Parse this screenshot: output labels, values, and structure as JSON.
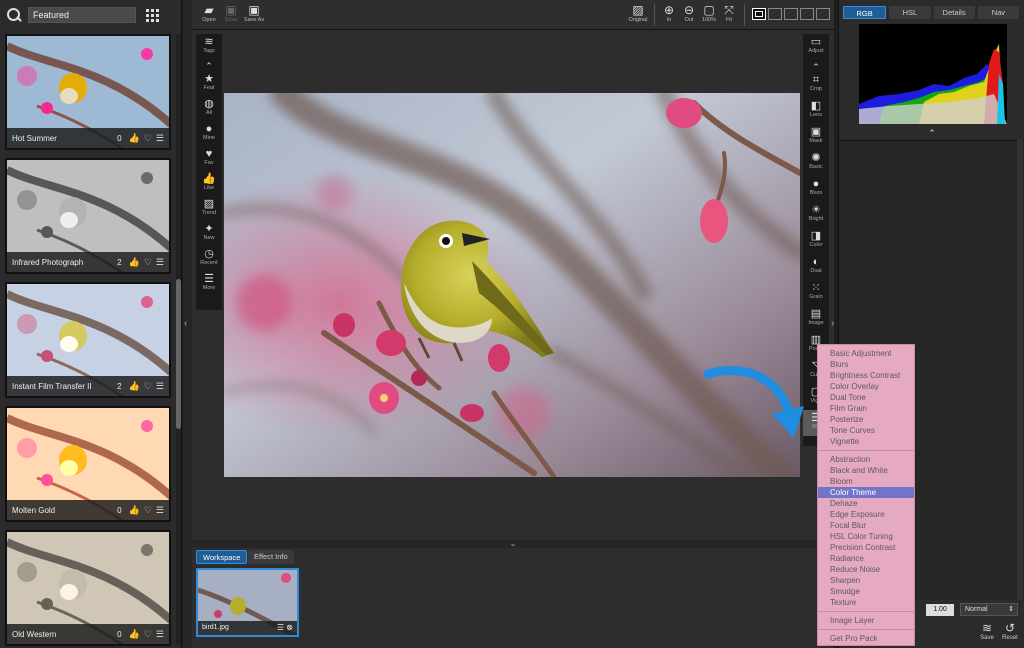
{
  "search": {
    "value": "Featured"
  },
  "presets": [
    {
      "name": "Hot Summer",
      "likes": "0",
      "liked": false
    },
    {
      "name": "Infrared Photograph",
      "likes": "2",
      "liked": false
    },
    {
      "name": "Instant Film Transfer II",
      "likes": "2",
      "liked": true
    },
    {
      "name": "Molten Gold",
      "likes": "0",
      "liked": false
    },
    {
      "name": "Old Western",
      "likes": "0",
      "liked": false
    }
  ],
  "toolbar": {
    "open": "Open",
    "save": "Save",
    "save_as": "Save As",
    "original": "Original",
    "zoom_in": "In",
    "zoom_out": "Out",
    "zoom_100": "100%",
    "fit": "Fit"
  },
  "left_tools": [
    {
      "label": "Tags",
      "icon": "layers-icon",
      "glyph": "≋"
    },
    {
      "label": "Feat",
      "icon": "star-icon",
      "glyph": "★"
    },
    {
      "label": "All",
      "icon": "globe-icon",
      "glyph": "◍"
    },
    {
      "label": "Mine",
      "icon": "user-icon",
      "glyph": "●"
    },
    {
      "label": "Fav",
      "icon": "heart-icon",
      "glyph": "♥"
    },
    {
      "label": "Like",
      "icon": "thumbs-up-icon",
      "glyph": "👍"
    },
    {
      "label": "Trend",
      "icon": "trend-icon",
      "glyph": "▨"
    },
    {
      "label": "New",
      "icon": "sparkle-icon",
      "glyph": "✦"
    },
    {
      "label": "Recent",
      "icon": "clock-icon",
      "glyph": "◷"
    },
    {
      "label": "More",
      "icon": "more-icon",
      "glyph": "☰"
    }
  ],
  "right_tools": [
    {
      "label": "Adjust",
      "icon": "toolbox-icon",
      "glyph": "▭"
    },
    {
      "label": "Crop",
      "icon": "crop-icon",
      "glyph": "⌗"
    },
    {
      "label": "Lens",
      "icon": "lens-icon",
      "glyph": "◧"
    },
    {
      "label": "Mask",
      "icon": "mask-icon",
      "glyph": "▣"
    },
    {
      "label": "Basic",
      "icon": "aperture-icon",
      "glyph": "✺"
    },
    {
      "label": "Blurs",
      "icon": "blur-icon",
      "glyph": "●"
    },
    {
      "label": "Bright",
      "icon": "sun-icon",
      "glyph": "☀"
    },
    {
      "label": "Color",
      "icon": "color-icon",
      "glyph": "◨"
    },
    {
      "label": "Dual",
      "icon": "dual-icon",
      "glyph": "◐"
    },
    {
      "label": "Grain",
      "icon": "grain-icon",
      "glyph": "⁙"
    },
    {
      "label": "Image",
      "icon": "image-icon",
      "glyph": "▤"
    },
    {
      "label": "Poste",
      "icon": "posterize-icon",
      "glyph": "▥"
    },
    {
      "label": "Curv",
      "icon": "curves-icon",
      "glyph": "◹"
    },
    {
      "label": "Vign",
      "icon": "vignette-icon",
      "glyph": "▢"
    },
    {
      "label": "Mo",
      "icon": "more-icon",
      "glyph": "☰"
    }
  ],
  "menu": {
    "group1": [
      "Basic Adjustment",
      "Blurs",
      "Brightness Contrast",
      "Color Overlay",
      "Dual Tone",
      "Film Grain",
      "Posterize",
      "Tone Curves",
      "Vignette"
    ],
    "group2": [
      "Abstraction",
      "Black and White",
      "Bloom",
      "Color Theme",
      "Dehaze",
      "Edge Exposure",
      "Focal Blur",
      "HSL Color Tuning",
      "Precision Contrast",
      "Radiance",
      "Reduce Noise",
      "Sharpen",
      "Smudge",
      "Texture"
    ],
    "group3": [
      "Image Layer"
    ],
    "group4": [
      "Get Pro Pack"
    ],
    "selected": "Color Theme"
  },
  "workspace": {
    "tab_workspace": "Workspace",
    "tab_effect_info": "Effect Info",
    "file_name": "bird1.jpg"
  },
  "right_panel": {
    "tabs": [
      "RGB",
      "HSL",
      "Details",
      "Nav"
    ],
    "opacity": "1.00",
    "blend_mode": "Normal",
    "save": "Save",
    "reset": "Reset"
  },
  "colors": {
    "accent": "#1f5d97",
    "menu_bg": "#e6a9c2",
    "menu_selected": "#7174c8",
    "arrow": "#1f8de0"
  }
}
